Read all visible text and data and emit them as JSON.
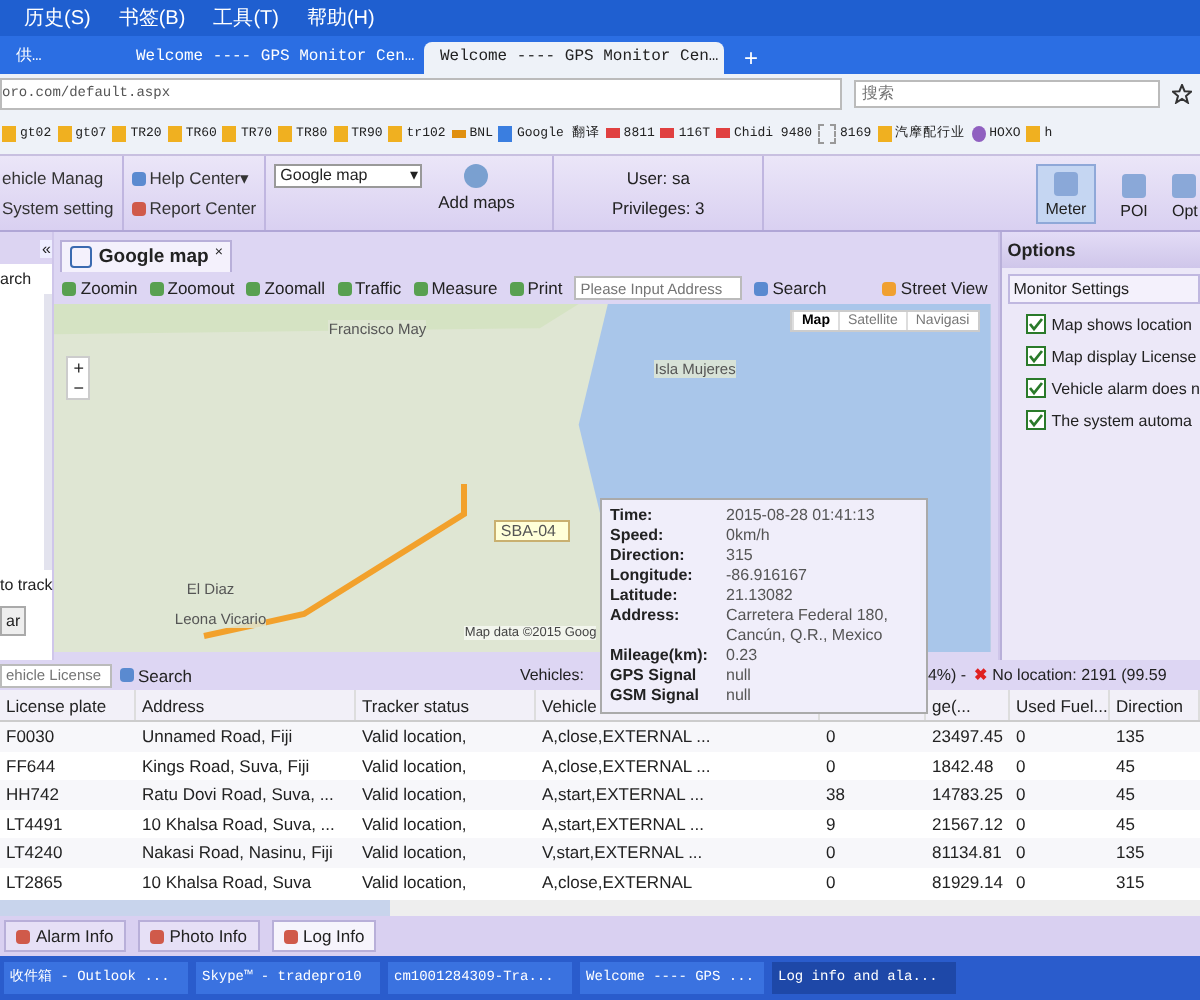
{
  "menu_bar": [
    "历史(S)",
    "书签(B)",
    "工具(T)",
    "帮助(H)"
  ],
  "browser_tabs": [
    {
      "title": "供…",
      "selected": false
    },
    {
      "title": "Welcome ---- GPS Monitor Cen…",
      "selected": false
    },
    {
      "title": "Welcome ---- GPS Monitor Cen…",
      "selected": true
    }
  ],
  "new_tab": "+",
  "address_bar": {
    "url": "oro.com/default.aspx",
    "search_placeholder": "搜索"
  },
  "bookmarks": [
    {
      "label": "gt02",
      "kind": "flag"
    },
    {
      "label": "gt07",
      "kind": "flag"
    },
    {
      "label": "TR20",
      "kind": "flag"
    },
    {
      "label": "TR60",
      "kind": "flag"
    },
    {
      "label": "TR70",
      "kind": "flag"
    },
    {
      "label": "TR80",
      "kind": "flag"
    },
    {
      "label": "TR90",
      "kind": "flag"
    },
    {
      "label": "tr102",
      "kind": "flag"
    },
    {
      "label": "BNL",
      "kind": "bar"
    },
    {
      "label": "Google 翻译",
      "kind": "doc"
    },
    {
      "label": "8811",
      "kind": "gps"
    },
    {
      "label": "116T",
      "kind": "gps"
    },
    {
      "label": "Chidi 9480",
      "kind": "gps"
    },
    {
      "label": "8169",
      "kind": "blank"
    },
    {
      "label": "汽摩配行业",
      "kind": "flag"
    },
    {
      "label": "HOXO",
      "kind": "circle"
    },
    {
      "label": "h",
      "kind": "flag"
    }
  ],
  "app_toolbar": {
    "menu_left": [
      "ehicle Manag",
      "System setting"
    ],
    "help_center": "Help Center",
    "help_caret": "▾",
    "report_center": "Report Center",
    "map_select": "Google map",
    "map_select_caret": "▾",
    "add_maps": "Add maps",
    "user": "User: sa",
    "privileges": "Privileges: 3",
    "tools": [
      {
        "label": "Meter",
        "selected": true
      },
      {
        "label": "POI",
        "selected": false
      },
      {
        "label": "Opt",
        "selected": false
      }
    ]
  },
  "left_panel": {
    "collapse": "«",
    "search_button": "arch",
    "track_text": "to track",
    "clear_button": "ar"
  },
  "map_panel": {
    "tab": "Google map",
    "tab_close": "×",
    "toolbar": [
      "Zoomin",
      "Zoomout",
      "Zoomall",
      "Traffic",
      "Measure",
      "Print"
    ],
    "address_placeholder": "Please Input Address",
    "search": "Search",
    "street_view": "Street View",
    "map_types": [
      {
        "label": "Map",
        "selected": true
      },
      {
        "label": "Satellite",
        "selected": false
      },
      {
        "label": "Navigasi",
        "selected": false
      }
    ],
    "zoom_in": "+",
    "zoom_out": "−",
    "map_labels": [
      "Francisco May",
      "Isla Mujeres",
      "El Diaz",
      "Leona Vicario"
    ],
    "marker_label": "SBA-04",
    "map_data": "Map data ©2015 Goog"
  },
  "info_popup": [
    {
      "label": "Time:",
      "value": "2015-08-28 01:41:13"
    },
    {
      "label": "Speed:",
      "value": "0km/h"
    },
    {
      "label": "Direction:",
      "value": "315"
    },
    {
      "label": "Longitude:",
      "value": "-86.916167"
    },
    {
      "label": "Latitude:",
      "value": "21.13082"
    },
    {
      "label": "Address:",
      "value": "Carretera Federal 180, Cancún, Q.R., Mexico"
    },
    {
      "label": "Mileage(km):",
      "value": "0.23"
    },
    {
      "label": "GPS Signal",
      "value": "null"
    },
    {
      "label": "GSM Signal",
      "value": "null"
    }
  ],
  "options_panel": {
    "title": "Options",
    "section": "Monitor Settings",
    "settings": [
      {
        "label": "Map shows location",
        "checked": true
      },
      {
        "label": "Map display License",
        "checked": true
      },
      {
        "label": "Vehicle alarm does n",
        "checked": true
      },
      {
        "label": "The system automa",
        "checked": true
      }
    ]
  },
  "vehicle_table": {
    "search_placeholder": "ehicle License",
    "search": "Search",
    "vehicles": "Vehicles:",
    "share": "4%) -",
    "no_location_icon": "✖",
    "no_location": "No location: 2191 (99.59",
    "columns": [
      {
        "label": "License plate"
      },
      {
        "label": "Address"
      },
      {
        "label": "Tracker status"
      },
      {
        "label": "Vehicle"
      },
      {},
      {
        "label": "ge(..."
      },
      {
        "label": "Used Fuel..."
      },
      {
        "label": "Direction"
      }
    ],
    "rows": [
      [
        "F0030",
        "Unnamed Road, Fiji",
        "Valid location,",
        "A,close,EXTERNAL ...",
        "0",
        "23497.45",
        "0",
        "135"
      ],
      [
        "FF644",
        "Kings Road, Suva, Fiji",
        "Valid location,",
        "A,close,EXTERNAL ...",
        "0",
        "1842.48",
        "0",
        "45"
      ],
      [
        "HH742",
        "Ratu Dovi Road, Suva, ...",
        "Valid location,",
        "A,start,EXTERNAL ...",
        "38",
        "14783.25",
        "0",
        "45"
      ],
      [
        "LT4491",
        "10 Khalsa Road, Suva, ...",
        "Valid location,",
        "A,start,EXTERNAL ...",
        "9",
        "21567.12",
        "0",
        "45"
      ],
      [
        "LT4240",
        "Nakasi Road, Nasinu, Fiji",
        "Valid location,",
        "V,start,EXTERNAL ...",
        "0",
        "81134.81",
        "0",
        "135"
      ],
      [
        "LT2865",
        "10 Khalsa Road, Suva",
        "Valid location,",
        "A,close,EXTERNAL",
        "0",
        "81929.14",
        "0",
        "315"
      ]
    ]
  },
  "bottom_tabs": [
    {
      "label": "Alarm Info",
      "selected": false
    },
    {
      "label": "Photo Info",
      "selected": false
    },
    {
      "label": "Log Info",
      "selected": true
    }
  ],
  "taskbar": [
    {
      "label": "收件箱 - Outlook ...",
      "selected": false
    },
    {
      "label": "Skype™ - tradepro10",
      "selected": false
    },
    {
      "label": "cm1001284309-Tra...",
      "selected": false
    },
    {
      "label": "Welcome ---- GPS ...",
      "selected": false
    },
    {
      "label": "Log info and ala...",
      "selected": true
    }
  ]
}
